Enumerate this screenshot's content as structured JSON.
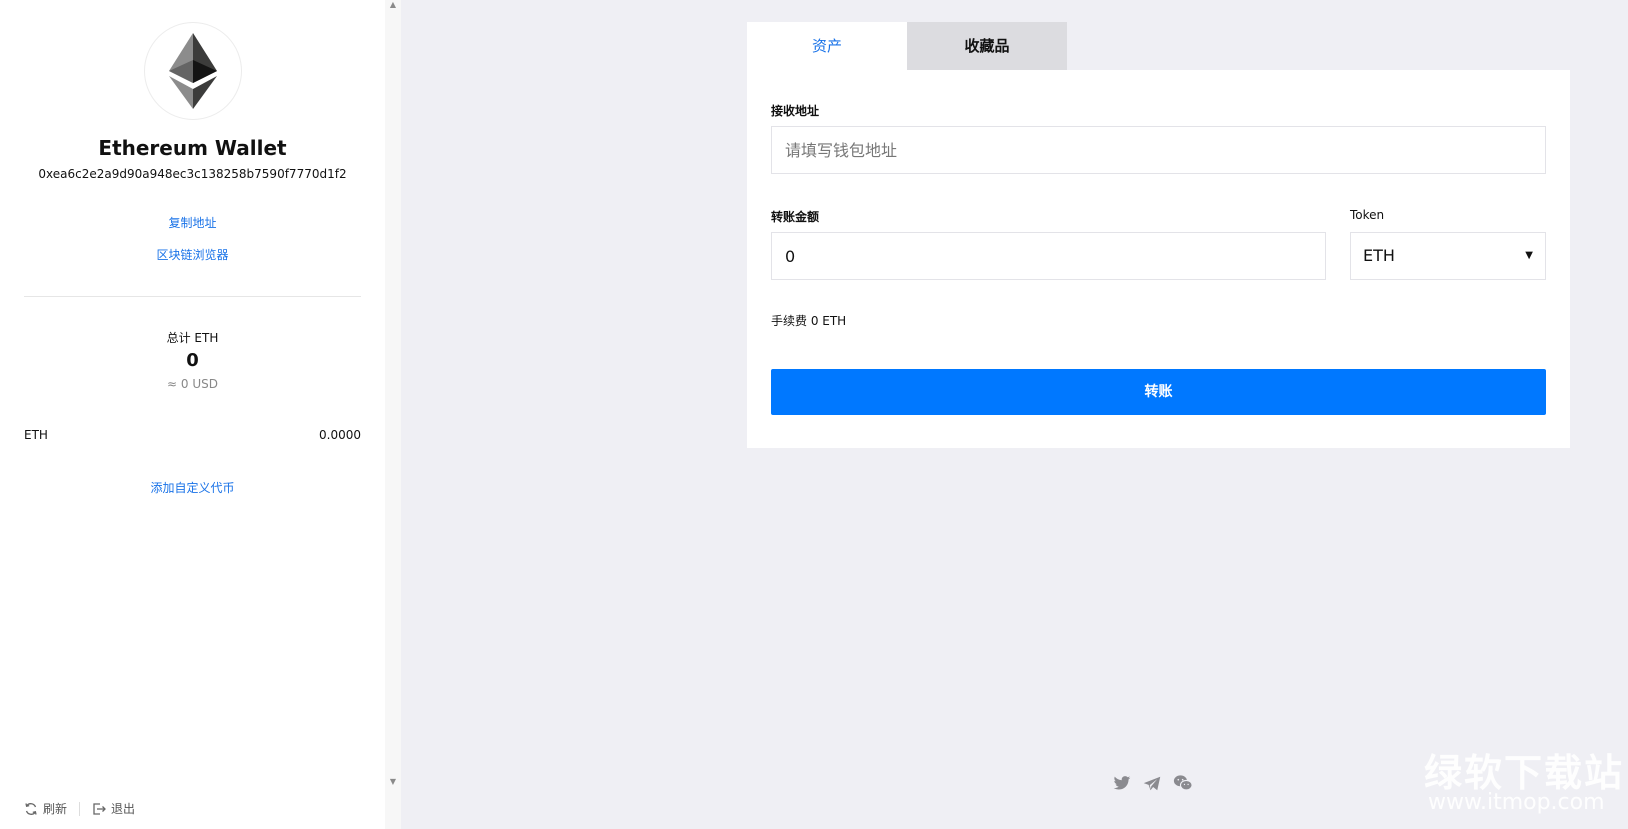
{
  "sidebar": {
    "wallet_title": "Ethereum Wallet",
    "address": "0xea6c2e2a9d90a948ec3c138258b7590f7770d1f2",
    "copy_address": "复制地址",
    "explorer": "区块链浏览器",
    "total_label": "总计 ETH",
    "total_value": "0",
    "total_usd": "≈ 0 USD",
    "tokens": [
      {
        "symbol": "ETH",
        "balance": "0.0000"
      }
    ],
    "add_token": "添加自定义代币",
    "footer": {
      "refresh": "刷新",
      "logout": "退出"
    }
  },
  "tabs": [
    {
      "label": "资产",
      "active": true
    },
    {
      "label": "收藏品",
      "active": false
    }
  ],
  "form": {
    "recipient_label": "接收地址",
    "recipient_placeholder": "请填写钱包地址",
    "recipient_value": "",
    "amount_label": "转账金额",
    "amount_value": "0",
    "token_label": "Token",
    "token_selected": "ETH",
    "fee_text": "手续费 0 ETH",
    "submit_label": "转账"
  },
  "social_icons": [
    "twitter-icon",
    "telegram-icon",
    "wechat-icon"
  ],
  "watermark": {
    "name": "绿软下载站",
    "url": "www.itmop.com"
  },
  "colors": {
    "accent": "#0078ff",
    "link": "#1a73e8",
    "background": "#efeff4"
  }
}
